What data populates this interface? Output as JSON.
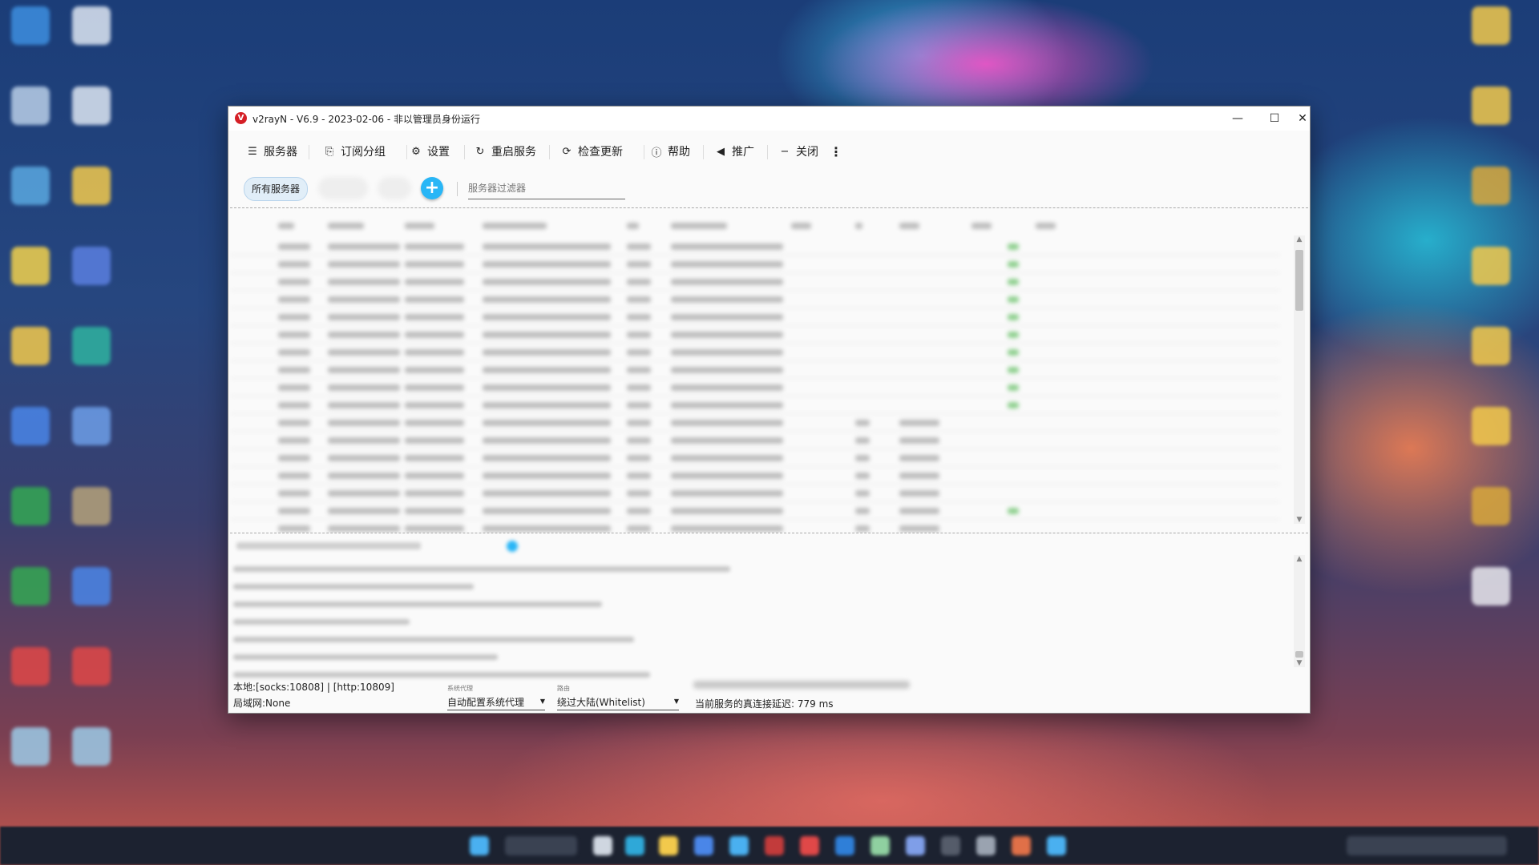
{
  "window": {
    "title": "v2rayN - V6.9 - 2023-02-06 - 非以管理员身份运行",
    "minimize_glyph": "—",
    "maximize_glyph": "☐",
    "close_glyph": "✕"
  },
  "toolbar": {
    "servers": "服务器",
    "subscription_groups": "订阅分组",
    "settings": "设置",
    "restart_service": "重启服务",
    "check_update": "检查更新",
    "help": "帮助",
    "promote": "推广",
    "close": "关闭",
    "more": "⋮"
  },
  "filter": {
    "all_servers": "所有服务器",
    "add": "+",
    "placeholder": "服务器过滤器"
  },
  "status": {
    "local_ports": "本地:[socks:10808] | [http:10809]",
    "lan": "局域网:None",
    "system_proxy_caption": "系统代理",
    "system_proxy_value": "自动配置系统代理",
    "routing_caption": "路由",
    "routing_value": "绕过大陆(Whitelist)",
    "latency": "当前服务的真连接延迟: 779 ms"
  },
  "colors": {
    "accent": "#29b6f6",
    "chip_bg": "#e1eef8",
    "logo_red": "#d51f26"
  },
  "icons": {
    "servers": "list-icon",
    "subscription_groups": "subscription-icon",
    "settings": "gear-icon",
    "restart_service": "refresh-icon",
    "check_update": "update-icon",
    "help": "help-icon",
    "promote": "speaker-icon",
    "close": "minus-icon"
  }
}
